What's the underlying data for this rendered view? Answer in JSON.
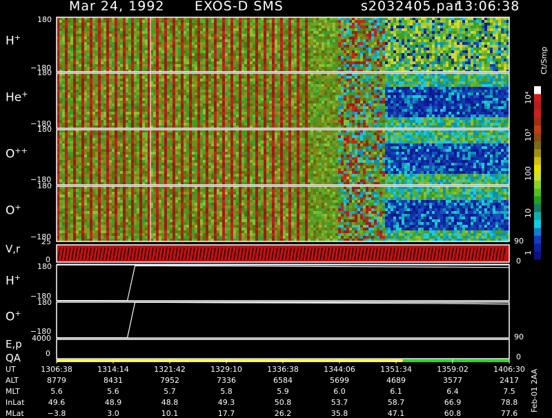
{
  "header": {
    "date": "Mar 24, 1992",
    "instrument": "EXOS-D SMS",
    "file": "s2032405.par",
    "time": "13:06:38"
  },
  "panels": {
    "spectrograms": [
      {
        "species": "H",
        "charge": "+",
        "ymax": "180",
        "ymin": "−180"
      },
      {
        "species": "He",
        "charge": "+",
        "ymax": "180",
        "ymin": "−180"
      },
      {
        "species": "O",
        "charge": "++",
        "ymax": "180",
        "ymin": "−180"
      },
      {
        "species": "O",
        "charge": "+",
        "ymax": "180",
        "ymin": "−180"
      }
    ],
    "vr": {
      "label": "V,r",
      "left_max": "25",
      "left_min": "0",
      "right_max": "90",
      "right_min": "0"
    },
    "hline": {
      "species": "H",
      "charge": "+",
      "ymax": "180",
      "ymin": "−180"
    },
    "oline": {
      "species": "O",
      "charge": "+",
      "ymax": "180",
      "ymin": "−180"
    },
    "ep": {
      "label": "E,p",
      "left_max": "4000",
      "right_max": "90"
    },
    "qa": {
      "label": "QA",
      "left_min": "0",
      "right_min": "0"
    }
  },
  "colorbar": {
    "unit": "Ct/Smp",
    "labels": [
      "10⁴",
      "10³",
      "100",
      "10",
      "1"
    ],
    "colors": [
      "#ffffff",
      "#d11a1a",
      "#b02020",
      "#cc2020",
      "#a03010",
      "#c04010",
      "#8a4a10",
      "#7a6a10",
      "#a09010",
      "#d0c010",
      "#e8e000",
      "#c8e030",
      "#90d020",
      "#50c020",
      "#20a020",
      "#108060",
      "#10b0b0",
      "#10d0e0",
      "#1080d0",
      "#1040c0",
      "#1020a0",
      "#101080"
    ]
  },
  "chart_data": [
    {
      "type": "heatmap",
      "title": "Mar 24, 1992   EXOS-D SMS",
      "description_panels": [
        "H+",
        "He+",
        "O++",
        "O+"
      ],
      "x_label_rows": [
        "UT",
        "ALT",
        "MLT",
        "InLat",
        "MLat"
      ],
      "ylim": [
        -180,
        180
      ],
      "colorbar_unit": "Ct/Smp",
      "colorbar_ticks": [
        "1",
        "10",
        "100",
        "10³",
        "10⁴"
      ]
    },
    {
      "type": "line",
      "series": [
        {
          "name": "H+",
          "x": [
            "1306:38",
            "1316:00",
            "1317:00",
            "1329:10",
            "1344:06",
            "1359:02",
            "1406:30"
          ],
          "y": [
            -177,
            -178,
            171,
            168,
            163,
            158,
            154
          ]
        },
        {
          "name": "O+",
          "x": [
            "1306:38",
            "1316:00",
            "1317:00",
            "1329:10",
            "1344:06",
            "1359:02",
            "1406:30"
          ],
          "y": [
            -177,
            -177,
            178,
            174,
            170,
            166,
            160
          ]
        }
      ],
      "ylim": [
        -180,
        180
      ]
    }
  ],
  "axis_table": {
    "rows": [
      {
        "label": "UT",
        "values": [
          "1306:38",
          "1314:14",
          "1321:42",
          "1329:10",
          "1336:38",
          "1344:06",
          "1351:34",
          "1359:02",
          "1406:30"
        ]
      },
      {
        "label": "ALT",
        "values": [
          "8779",
          "8431",
          "7952",
          "7336",
          "6584",
          "5699",
          "4689",
          "3577",
          "2417"
        ]
      },
      {
        "label": "MLT",
        "values": [
          "5.6",
          "5.6",
          "5.7",
          "5.8",
          "5.9",
          "6.0",
          "6.1",
          "6.4",
          "7.5"
        ]
      },
      {
        "label": "InLat",
        "values": [
          "49.6",
          "48.9",
          "48.8",
          "49.3",
          "50.8",
          "53.7",
          "58.7",
          "66.9",
          "78.8"
        ]
      },
      {
        "label": "MLat",
        "values": [
          "−3.8",
          "3.0",
          "10.1",
          "17.7",
          "26.2",
          "35.8",
          "47.1",
          "60.8",
          "77.6"
        ]
      }
    ]
  },
  "footer": {
    "stamp": "Feb-01 2AA"
  },
  "qa_bar": {
    "segments": [
      {
        "color": "#ffff40",
        "frac": 0.765
      },
      {
        "color": "#20e020",
        "frac": 0.235
      }
    ]
  }
}
